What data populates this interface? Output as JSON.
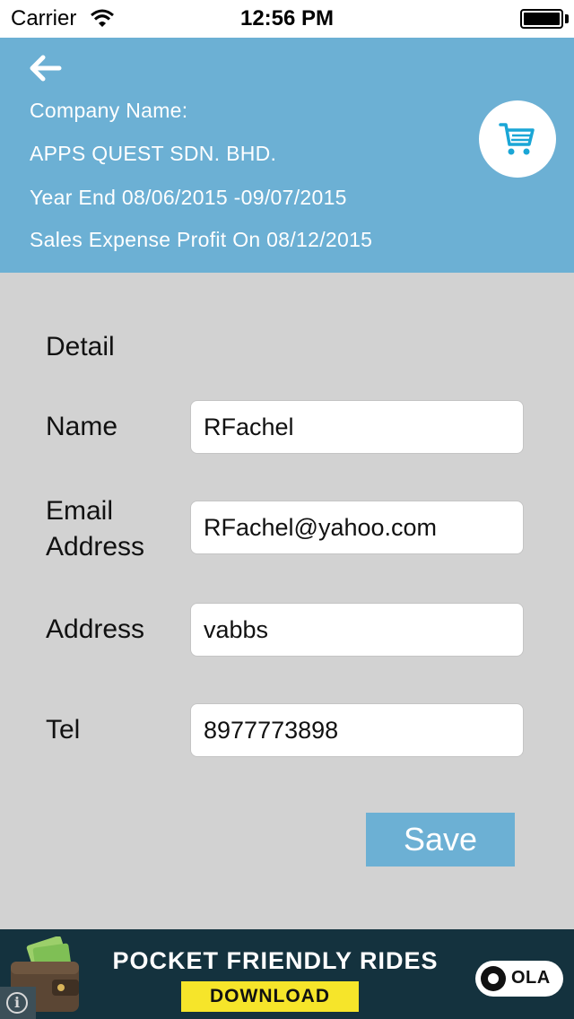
{
  "status_bar": {
    "carrier": "Carrier",
    "time": "12:56 PM"
  },
  "header": {
    "company_label": "Company Name:",
    "company_name": "APPS QUEST SDN. BHD.",
    "year_end": "Year End 08/06/2015 -09/07/2015",
    "sales_info": "Sales Expense Profit On 08/12/2015",
    "back_icon": "arrow-left-icon",
    "cart_icon": "cart-icon",
    "background_color": "#6cb0d4"
  },
  "form": {
    "section_title": "Detail",
    "fields": [
      {
        "label": "Name",
        "value": "RFachel"
      },
      {
        "label": "Email\nAddress",
        "value": "RFachel@yahoo.com"
      },
      {
        "label": "Address",
        "value": "vabbs"
      },
      {
        "label": "Tel",
        "value": "8977773898"
      }
    ],
    "save_label": "Save"
  },
  "ad": {
    "headline": "POCKET FRIENDLY RIDES",
    "cta": "DOWNLOAD",
    "brand": "OLA",
    "info_glyph": "i"
  }
}
